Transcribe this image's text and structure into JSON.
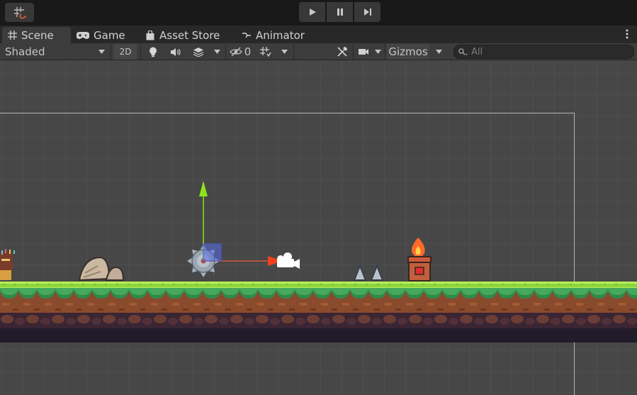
{
  "tabs": [
    {
      "label": "Scene",
      "icon": "grid-icon",
      "active": true
    },
    {
      "label": "Game",
      "icon": "gamepad-icon"
    },
    {
      "label": "Asset Store",
      "icon": "shopping-bag-icon"
    },
    {
      "label": "Animator",
      "icon": "animator-icon"
    }
  ],
  "toolbar": {
    "draw_mode": "Shaded",
    "mode_2d": "2D",
    "hidden_count": "0",
    "gizmos": "Gizmos",
    "search_placeholder": "All"
  },
  "colors": {
    "play_bar": "#191919",
    "panel": "#3c3c3c",
    "viewport": "#474747",
    "gizmo_y": "#8de31e",
    "gizmo_x": "#f0401f",
    "grass": "#7dcf3d",
    "dirt": "#8a4a2c"
  }
}
